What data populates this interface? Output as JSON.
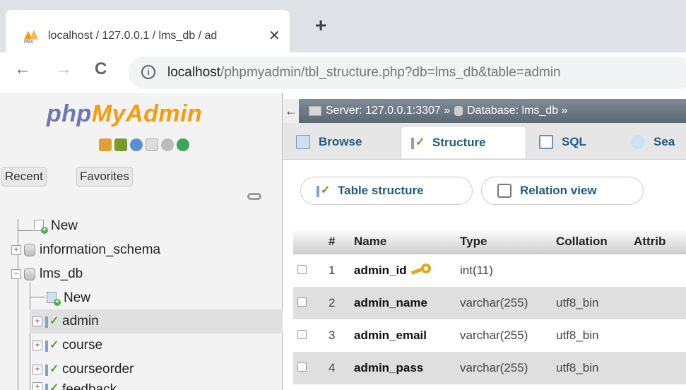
{
  "browser": {
    "tab_title": "localhost / 127.0.0.1 / lms_db / ad",
    "tab_close": "✕",
    "new_tab": "+",
    "url_host": "localhost",
    "url_path": "/phpmyadmin/tbl_structure.php?db=lms_db&table=admin",
    "back": "←",
    "forward": "→",
    "reload": "C",
    "info": "i"
  },
  "navigation": {
    "logo_php": "php",
    "logo_myadmin": "MyAdmin",
    "recent": "Recent",
    "favorites": "Favorites",
    "tree": [
      {
        "label": "New",
        "kind": "new",
        "level": 0
      },
      {
        "label": "information_schema",
        "kind": "db",
        "level": 0,
        "expander": "+"
      },
      {
        "label": "lms_db",
        "kind": "db",
        "level": 0,
        "expander": "−"
      },
      {
        "label": "New",
        "kind": "new",
        "level": 1
      },
      {
        "label": "admin",
        "kind": "table",
        "level": 1,
        "expander": "+",
        "selected": true
      },
      {
        "label": "course",
        "kind": "table",
        "level": 1,
        "expander": "+"
      },
      {
        "label": "courseorder",
        "kind": "table",
        "level": 1,
        "expander": "+"
      },
      {
        "label": "feedback",
        "kind": "table",
        "level": 1,
        "expander": "+"
      }
    ]
  },
  "main": {
    "back_arrow": "←",
    "breadcrumb": "Server: 127.0.0.1:3307 » ",
    "breadcrumb_db": "Database: lms_db » ",
    "tabs": [
      "Browse",
      "Structure",
      "SQL",
      "Sea"
    ],
    "active_tab": "Structure",
    "subtabs": [
      "Table structure",
      "Relation view"
    ],
    "columns": [
      "#",
      "Name",
      "Type",
      "Collation",
      "Attrib"
    ],
    "rows": [
      {
        "num": "1",
        "name": "admin_id",
        "type": "int(11)",
        "collation": "",
        "primary": true
      },
      {
        "num": "2",
        "name": "admin_name",
        "type": "varchar(255)",
        "collation": "utf8_bin"
      },
      {
        "num": "3",
        "name": "admin_email",
        "type": "varchar(255)",
        "collation": "utf8_bin"
      },
      {
        "num": "4",
        "name": "admin_pass",
        "type": "varchar(255)",
        "collation": "utf8_bin"
      }
    ]
  },
  "colors": {
    "link_blue": "#235a81",
    "logo_blue": "#6c78af",
    "logo_orange": "#f89c0e",
    "row_even": "#dfdfdf"
  },
  "icons": [
    "pma-favicon",
    "home-icon",
    "database-icon",
    "help-icon",
    "docs-icon",
    "settings-icon",
    "reload-icon",
    "link-icon",
    "key-icon"
  ]
}
